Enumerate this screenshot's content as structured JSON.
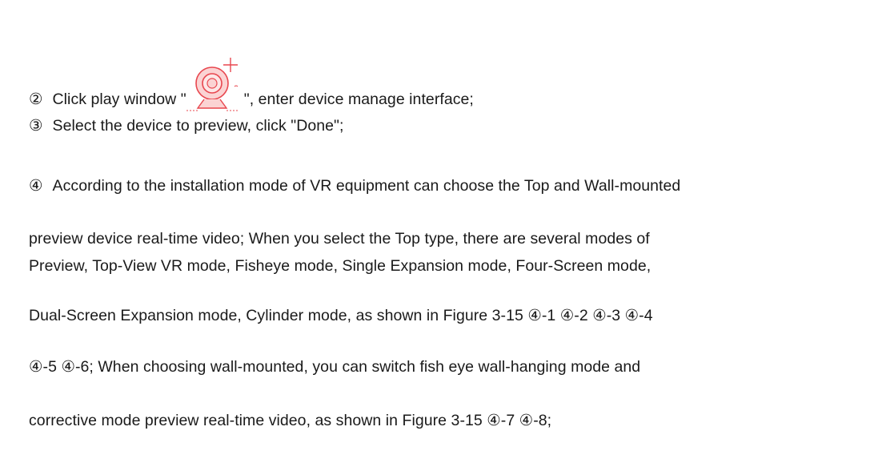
{
  "steps": [
    {
      "marker": "②",
      "text_before_icon": "Click play window \"",
      "icon": "camera-add-icon",
      "text_after_icon": "\", enter device manage interface;"
    },
    {
      "marker": "③",
      "text": "Select the device to preview, click \"Done\";"
    },
    {
      "marker": "④",
      "first_line": "According to the installation mode of VR equipment can choose the Top and Wall-mounted",
      "continuation_lines": [
        "preview device real-time video; When you select the Top type, there are several modes of",
        "Preview, Top-View VR mode, Fisheye mode, Single Expansion mode, Four-Screen mode,",
        "Dual-Screen Expansion mode, Cylinder mode, as shown in Figure 3-15 ④-1 ④-2 ④-3 ④-4",
        "④-5 ④-6; When choosing wall-mounted, you can switch fish eye wall-hanging mode and",
        "corrective mode preview real-time video, as shown in Figure 3-15 ④-7 ④-8;"
      ]
    }
  ],
  "colors": {
    "text": "#1a1a1a",
    "icon_accent": "#e8474f",
    "icon_fill": "#fbd3d3"
  }
}
